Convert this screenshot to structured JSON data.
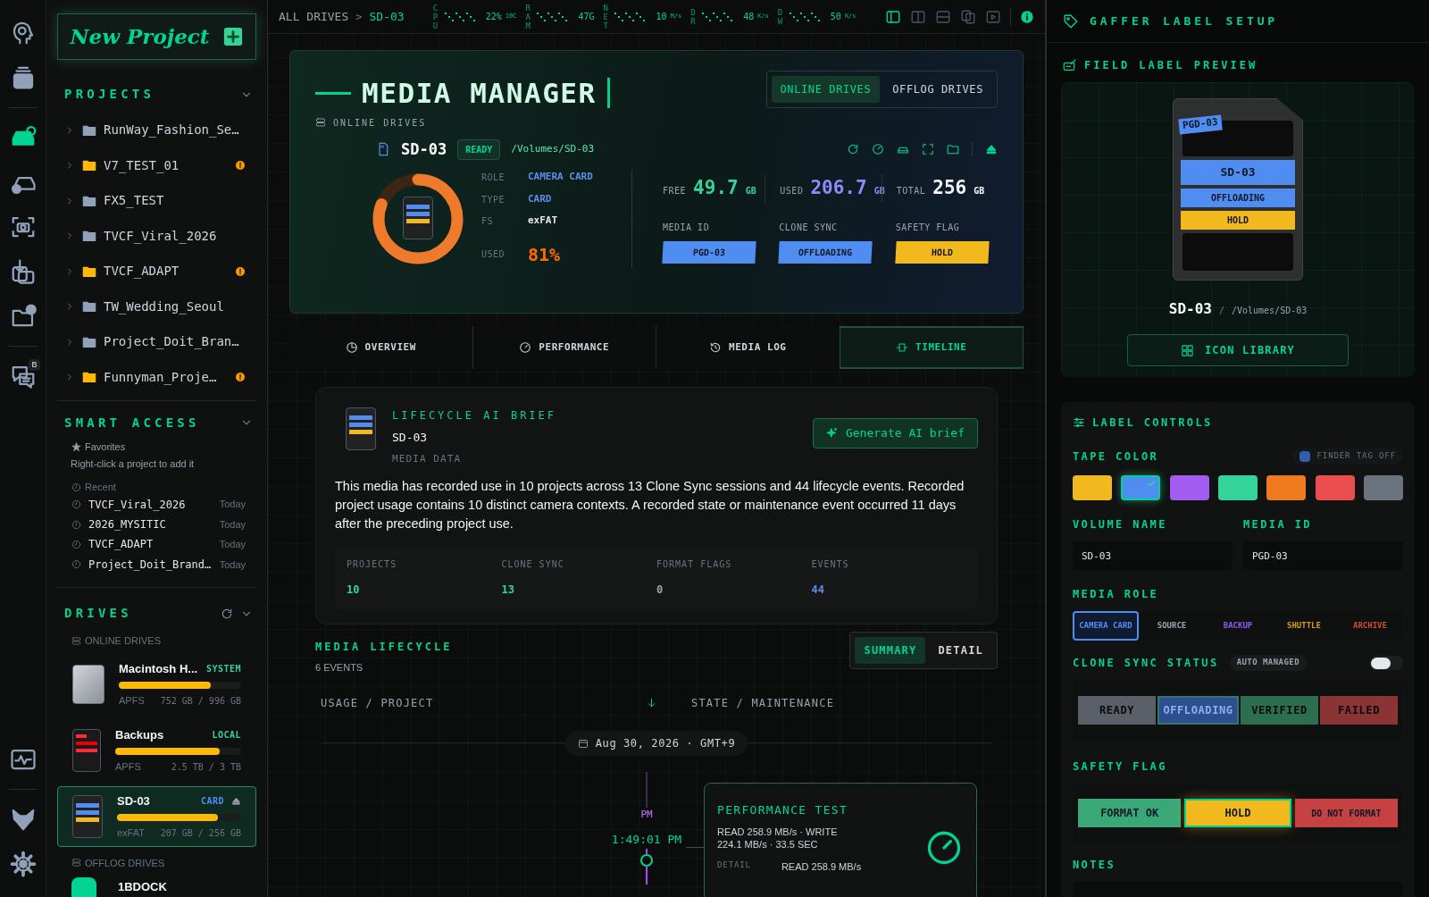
{
  "rail": {
    "top_groups": [
      [
        {
          "kind": "brain",
          "selected": false
        },
        {
          "kind": "stack",
          "selected": false
        }
      ],
      [
        {
          "kind": "drive",
          "selected": true
        },
        {
          "kind": "drive-check",
          "selected": false
        },
        {
          "kind": "camera",
          "selected": false
        },
        {
          "kind": "import",
          "selected": false
        },
        {
          "kind": "folder-help",
          "selected": false
        }
      ],
      [
        {
          "kind": "chat",
          "selected": false,
          "badge": "B"
        }
      ]
    ],
    "bottom_groups": [
      [
        {
          "kind": "pulse",
          "selected": false
        }
      ],
      [
        {
          "kind": "wolf",
          "selected": false
        },
        {
          "kind": "settings",
          "selected": false
        }
      ]
    ]
  },
  "sidebar": {
    "new_project": "New Project",
    "projects": {
      "title": "PROJECTS",
      "items": [
        {
          "name": "RunWay_Fashion_Se…",
          "warning": false
        },
        {
          "name": "V7_TEST_01",
          "warning": true
        },
        {
          "name": "FX5_TEST",
          "warning": false
        },
        {
          "name": "TVCF_Viral_2026",
          "warning": false
        },
        {
          "name": "TVCF_ADAPT",
          "warning": true
        },
        {
          "name": "TW_Wedding_Seoul",
          "warning": false
        },
        {
          "name": "Project_Doit_Bran…",
          "warning": false
        },
        {
          "name": "Funnyman_Proje…",
          "warning": true
        }
      ]
    },
    "smart_access": {
      "title": "SMART ACCESS",
      "favorites_label": "Favorites",
      "favorites_hint": "Right-click a project to add it",
      "recent_label": "Recent",
      "recent": [
        {
          "name": "TVCF_Viral_2026",
          "time": "Today"
        },
        {
          "name": "2026_MYSITIC",
          "time": "Today"
        },
        {
          "name": "TVCF_ADAPT",
          "time": "Today"
        },
        {
          "name": "Project_Doit_Brand…",
          "time": "Today"
        }
      ]
    },
    "drives": {
      "title": "DRIVES",
      "online_label": "ONLINE DRIVES",
      "online": [
        {
          "kind": "hdd",
          "name": "Macintosh H...",
          "tag": "SYSTEM",
          "color": "#34d399",
          "level": 0.75,
          "fs": "APFS",
          "capacity": "752 GB / 996 GB",
          "selected": false,
          "ejectable": false
        },
        {
          "kind": "ssd",
          "name": "Backups",
          "tag": "LOCAL",
          "color": "#34d399",
          "level": 0.83,
          "fs": "APFS",
          "capacity": "2.5 TB / 3 TB",
          "selected": false,
          "ejectable": false
        },
        {
          "kind": "sd",
          "name": "SD-03",
          "tag": "CARD",
          "color": "#4f8df0",
          "level": 0.81,
          "fs": "exFAT",
          "capacity": "207 GB / 256 GB",
          "selected": true,
          "ejectable": true
        }
      ],
      "offlog_label": "OFFLOG DRIVES",
      "offlog": [
        {
          "name": "1BDOCK"
        }
      ]
    }
  },
  "topbar": {
    "breadcrumb": [
      "ALL DRIVES",
      "SD-03"
    ],
    "separator": ">",
    "stats": [
      {
        "label": "CPU",
        "value": "22%",
        "unit": "10C"
      },
      {
        "label": "RAM",
        "value": "47G"
      },
      {
        "label": "NET",
        "value": "10",
        "unit": "M/s"
      },
      {
        "label": "DR",
        "value": "48",
        "unit": "K/s"
      },
      {
        "label": "DW",
        "value": "50",
        "unit": "K/s"
      }
    ],
    "layouts": [
      {
        "kind": "sidebar",
        "selected": true
      },
      {
        "kind": "split-v",
        "selected": false
      },
      {
        "kind": "split-h",
        "selected": false
      },
      {
        "kind": "compare",
        "selected": false
      },
      {
        "kind": "play",
        "selected": false
      }
    ]
  },
  "header": {
    "title": "MEDIA MANAGER",
    "subtitle": "ONLINE DRIVES",
    "views": [
      {
        "label": "ONLINE DRIVES",
        "selected": true
      },
      {
        "label": "OFFLOG DRIVES",
        "selected": false
      }
    ],
    "drive": {
      "name": "SD-03",
      "status": "READY",
      "path": "/Volumes/SD-03",
      "info": [
        {
          "label": "ROLE",
          "value": "CAMERA CARD",
          "color": "#5b8def"
        },
        {
          "label": "TYPE",
          "value": "CARD",
          "color": "#5b8def"
        },
        {
          "label": "FS",
          "value": "exFAT",
          "color": "#e5e7eb"
        }
      ],
      "usage": {
        "label": "USED",
        "level": 0.81,
        "reading": "81%"
      },
      "capacities": [
        {
          "label": "FREE",
          "value": "49.7",
          "unit": "GB",
          "color": "#34d399"
        },
        {
          "label": "USED",
          "value": "206.7",
          "unit": "GB",
          "color": "#8b8cf5"
        },
        {
          "label": "TOTAL",
          "value": "256",
          "unit": "GB",
          "color": "#f3f4f6"
        }
      ],
      "tapes": [
        {
          "label": "MEDIA ID",
          "value": "PGD-03",
          "color": "#4f8df0"
        },
        {
          "label": "CLONE SYNC",
          "value": "OFFLOADING",
          "color": "#4f8df0"
        },
        {
          "label": "SAFETY FLAG",
          "value": "HOLD",
          "color": "#f2b91f"
        }
      ]
    }
  },
  "tabs": [
    {
      "label": "OVERVIEW",
      "kind": "overview",
      "selected": false
    },
    {
      "label": "PERFORMANCE",
      "kind": "performance",
      "selected": false
    },
    {
      "label": "MEDIA LOG",
      "kind": "log",
      "selected": false
    },
    {
      "label": "TIMELINE",
      "kind": "timeline",
      "selected": true
    }
  ],
  "brief": {
    "title": "LIFECYCLE AI BRIEF",
    "name": "SD-03",
    "subtitle": "MEDIA DATA",
    "button": "Generate AI brief",
    "text": "This media has recorded use in 10 projects across 13 Clone Sync sessions and 44 lifecycle events. Recorded project usage contains 10 distinct camera contexts. A recorded state or maintenance event occurred 11 days after the preceding project use.",
    "metrics": [
      {
        "label": "PROJECTS",
        "value": "10",
        "color": "#34d399"
      },
      {
        "label": "CLONE SYNC",
        "value": "13",
        "color": "#34d399"
      },
      {
        "label": "FORMAT FLAGS",
        "value": "0",
        "color": "#9ca3af"
      },
      {
        "label": "EVENTS",
        "value": "44",
        "color": "#5b8def"
      }
    ]
  },
  "lifecycle": {
    "title": "MEDIA LIFECYCLE",
    "count": "6 EVENTS",
    "views": [
      {
        "label": "SUMMARY",
        "selected": true
      },
      {
        "label": "DETAIL",
        "selected": false
      }
    ],
    "left_label": "USAGE / PROJECT",
    "right_label": "STATE / MAINTENANCE",
    "date": "Aug 30, 2026 · GMT+9",
    "event": {
      "period": "PM",
      "time": "1:49:01 PM",
      "title": "PERFORMANCE TEST",
      "text": "READ 258.9 MB/s · WRITE 224.1 MB/s · 33.5 SEC",
      "detail_label": "DETAIL",
      "detail": "READ 258.9 MB/s"
    }
  },
  "right": {
    "title": "GAFFER LABEL SETUP",
    "preview": {
      "title": "FIELD LABEL PREVIEW",
      "id_tape": "PGD-03",
      "tapes": [
        {
          "value": "SD-03",
          "color": "#4f8df0"
        },
        {
          "value": "OFFLOADING",
          "color": "#4f8df0"
        },
        {
          "value": "HOLD",
          "color": "#f2b91f"
        }
      ],
      "name": "SD-03",
      "separator": "/",
      "path": "/Volumes/SD-03",
      "button": "ICON LIBRARY"
    },
    "controls": {
      "title": "LABEL CONTROLS",
      "tape_color_label": "TAPE COLOR",
      "finder_tag": "FINDER TAG OFF",
      "swatches": [
        {
          "color": "#f2b91f",
          "selected": false
        },
        {
          "color": "#4f8df0",
          "selected": true
        },
        {
          "color": "#a35cf0",
          "selected": false
        },
        {
          "color": "#34d399",
          "selected": false
        },
        {
          "color": "#f07a1f",
          "selected": false
        },
        {
          "color": "#ea4d4d",
          "selected": false
        },
        {
          "color": "#6b7280",
          "selected": false
        }
      ],
      "volume_label": "VOLUME NAME",
      "volume": "SD-03",
      "media_id_label": "MEDIA ID",
      "media_id": "PGD-03",
      "role_label": "MEDIA ROLE",
      "roles": [
        {
          "label": "CAMERA CARD",
          "color": "#4f8df0",
          "selected": true
        },
        {
          "label": "SOURCE",
          "color": "#9ca3af",
          "selected": false
        },
        {
          "label": "BACKUP",
          "color": "#8b5cf6",
          "selected": false
        },
        {
          "label": "SHUTTLE",
          "color": "#d59a1a",
          "selected": false
        },
        {
          "label": "ARCHIVE",
          "color": "#d9482b",
          "selected": false
        }
      ],
      "sync_label": "CLONE SYNC STATUS",
      "sync_badge": "AUTO MANAGED",
      "auto_on": false,
      "sync": [
        {
          "label": "READY",
          "color": "#5a5f68",
          "selected": false
        },
        {
          "label": "OFFLOADING",
          "color": "#2e4f8f",
          "selected": true
        },
        {
          "label": "VERIFIED",
          "color": "#2c6e50",
          "selected": false
        },
        {
          "label": "FAILED",
          "color": "#8a3434",
          "selected": false
        }
      ],
      "flag_label": "SAFETY FLAG",
      "flags": [
        {
          "label": "FORMAT OK",
          "color": "#3aa776",
          "selected": false
        },
        {
          "label": "HOLD",
          "color": "#f2b91f",
          "selected": true
        },
        {
          "label": "DO NOT FORMAT",
          "color": "#c64242",
          "selected": false
        }
      ],
      "notes_label": "NOTES"
    }
  }
}
